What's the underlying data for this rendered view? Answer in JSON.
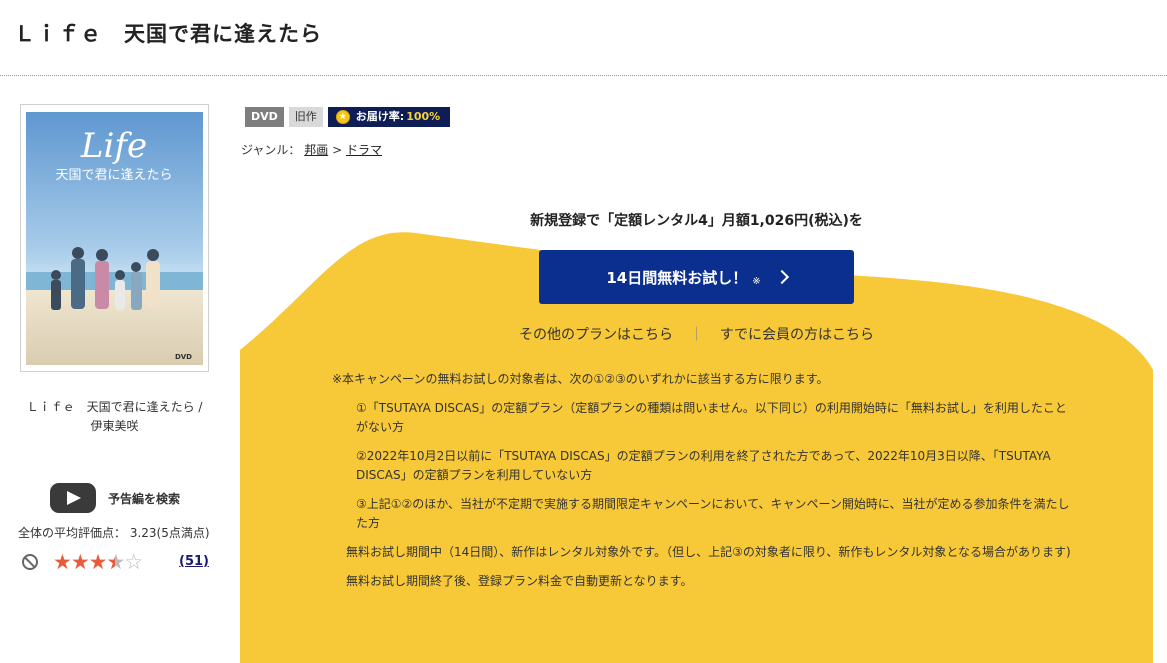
{
  "page_title": "Ｌｉｆｅ　天国で君に逢えたら",
  "cover": {
    "title_logo": "Life",
    "title_sub": "天国で君に逢えたら",
    "format_mark": "DVD"
  },
  "cover_caption": {
    "title": "Ｌｉｆｅ　天国で君に逢えたら /",
    "author": "伊東美咲"
  },
  "trailer": {
    "label": "予告編を検索",
    "icon": "play-icon"
  },
  "rating": {
    "text": "全体の平均評価点： 3.23(5点満点)",
    "value": 3.23,
    "max": 5,
    "review_count": "(51)",
    "colors": {
      "star_filled": "#e85c3d",
      "star_empty": "#bbbbbb"
    }
  },
  "badges": {
    "format": "DVD",
    "release_type": "旧作",
    "delivery_label": "お届け率:",
    "delivery_value": "100%"
  },
  "genre": {
    "label": "ジャンル：",
    "level1": "邦画",
    "separator": ">",
    "level2": "ドラマ"
  },
  "promo": {
    "headline": "新規登録で「定額レンタル4」月額1,026円(税込)を",
    "trial_button": "14日間無料お試し！",
    "trial_mark": "※",
    "other_plans_link": "その他のプランはこちら",
    "separator": "｜",
    "member_link": "すでに会員の方はこちら",
    "colors": {
      "background": "#f7c837",
      "button": "#0a2f8f"
    }
  },
  "notes": {
    "intro": "※本キャンペーンの無料お試しの対象者は、次の①②③のいずれかに該当する方に限ります。",
    "items": [
      "①「TSUTAYA DISCAS」の定額プラン（定額プランの種類は問いません。以下同じ）の利用開始時に「無料お試し」を利用したことがない方",
      "②2022年10月2日以前に「TSUTAYA DISCAS」の定額プランの利用を終了された方であって、2022年10月3日以降、「TSUTAYA DISCAS」の定額プランを利用していない方",
      "③上記①②のほか、当社が不定期で実施する期間限定キャンペーンにおいて、キャンペーン開始時に、当社が定める参加条件を満たした方"
    ],
    "trial_period": "無料お試し期間中（14日間）、新作はレンタル対象外です。（但し、上記③の対象者に限り、新作もレンタル対象となる場合があります)",
    "after_trial": "無料お試し期間終了後、登録プラン料金で自動更新となります。"
  }
}
